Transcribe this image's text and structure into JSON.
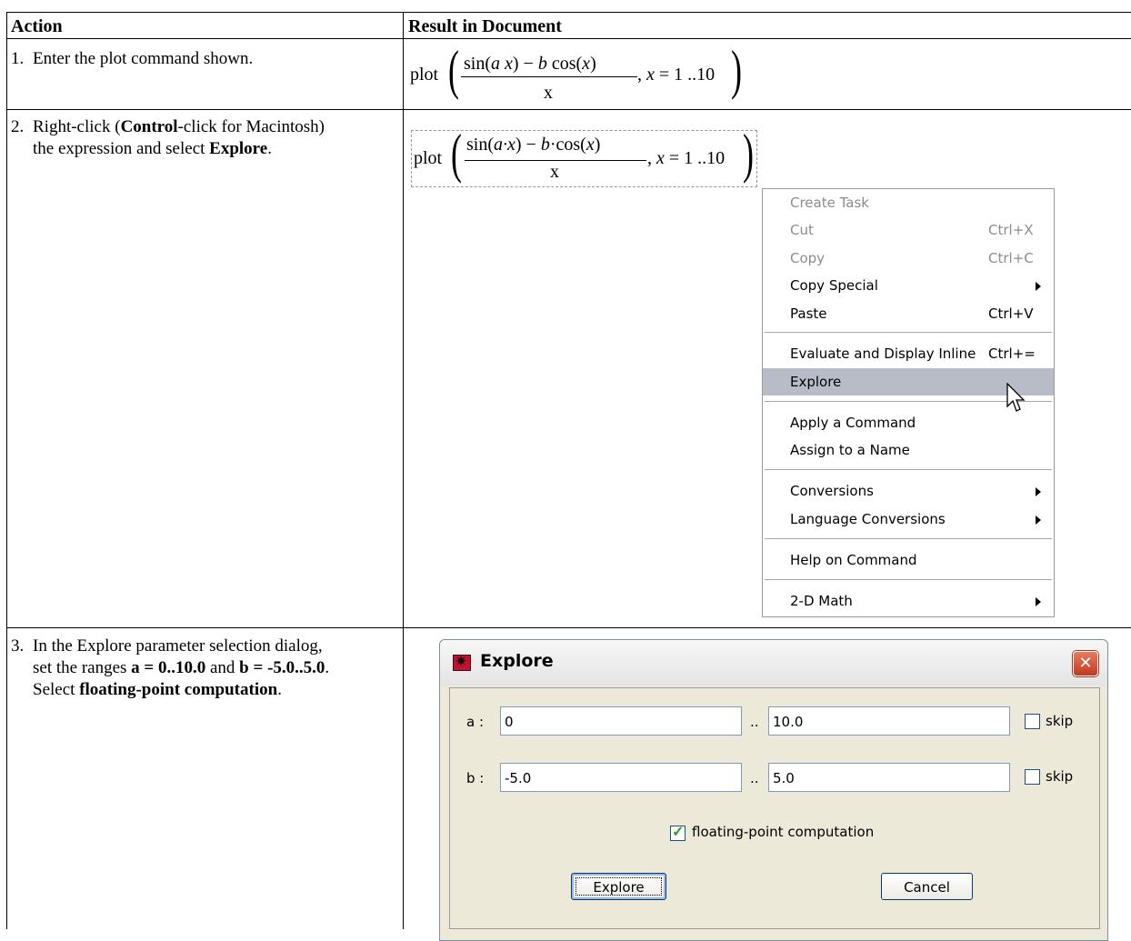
{
  "table": {
    "headers": [
      "Action",
      "Result in Document"
    ],
    "rows": [
      {
        "num": "1.",
        "line1": "Enter the plot command shown."
      },
      {
        "num": "2.",
        "line1_a": "Right-click (",
        "line1_b": "Control",
        "line1_c": "-click for Macintosh)",
        "line2_a": "the expression and select ",
        "line2_b": "Explore",
        "line2_c": "."
      },
      {
        "num": "3.",
        "line1": "In the Explore parameter selection dialog,",
        "line2_a": "set the ranges ",
        "line2_b": "a = 0..10.0",
        "line2_c": " and ",
        "line2_d": "b = -5.0..5.0",
        "line2_e": ".",
        "line3_a": "Select ",
        "line3_b": "floating-point computation",
        "line3_c": "."
      }
    ]
  },
  "math1": {
    "fn": "plot",
    "num_a": "sin(",
    "num_b": "a x",
    "num_c": ") − ",
    "num_d": "b",
    "num_e": " cos(",
    "num_f": "x",
    "num_g": ")",
    "den": "x",
    "tail_a": ", ",
    "tail_b": "x",
    "tail_c": " = 1 ..10"
  },
  "math2": {
    "fn": "plot",
    "num_a": "sin(",
    "num_b": "a·x",
    "num_c": ") − ",
    "num_d": "b",
    "num_e": "·cos(",
    "num_f": "x",
    "num_g": ")",
    "den": "x",
    "tail_a": ", ",
    "tail_b": "x",
    "tail_c": " = 1 ..10"
  },
  "menu": {
    "items": [
      {
        "label": "Create Task",
        "shortcut": "",
        "disabled": true
      },
      {
        "label": "Cut",
        "shortcut": "Ctrl+X",
        "disabled": true
      },
      {
        "label": "Copy",
        "shortcut": "Ctrl+C",
        "disabled": true
      },
      {
        "label": "Copy Special",
        "shortcut": "",
        "submenu": true
      },
      {
        "label": "Paste",
        "shortcut": "Ctrl+V"
      },
      {
        "label": "Evaluate and Display Inline",
        "shortcut": "Ctrl+="
      },
      {
        "label": "Explore",
        "shortcut": "",
        "highlighted": true
      },
      {
        "label": "Apply a Command",
        "shortcut": ""
      },
      {
        "label": "Assign to a Name",
        "shortcut": ""
      },
      {
        "label": "Conversions",
        "shortcut": "",
        "submenu": true
      },
      {
        "label": "Language Conversions",
        "shortcut": "",
        "submenu": true
      },
      {
        "label": "Help on Command",
        "shortcut": ""
      },
      {
        "label": "2-D Math",
        "shortcut": "",
        "submenu": true
      }
    ]
  },
  "dialog": {
    "title": "Explore",
    "close": "✕",
    "a_label": "a :",
    "a_from": "0",
    "a_to": "10.0",
    "b_label": "b :",
    "b_from": "-5.0",
    "b_to": "5.0",
    "range_sep": "..",
    "skip_label": "skip",
    "float_label": "floating-point computation",
    "float_checked": true,
    "explore_button": "Explore",
    "cancel_button": "Cancel"
  }
}
